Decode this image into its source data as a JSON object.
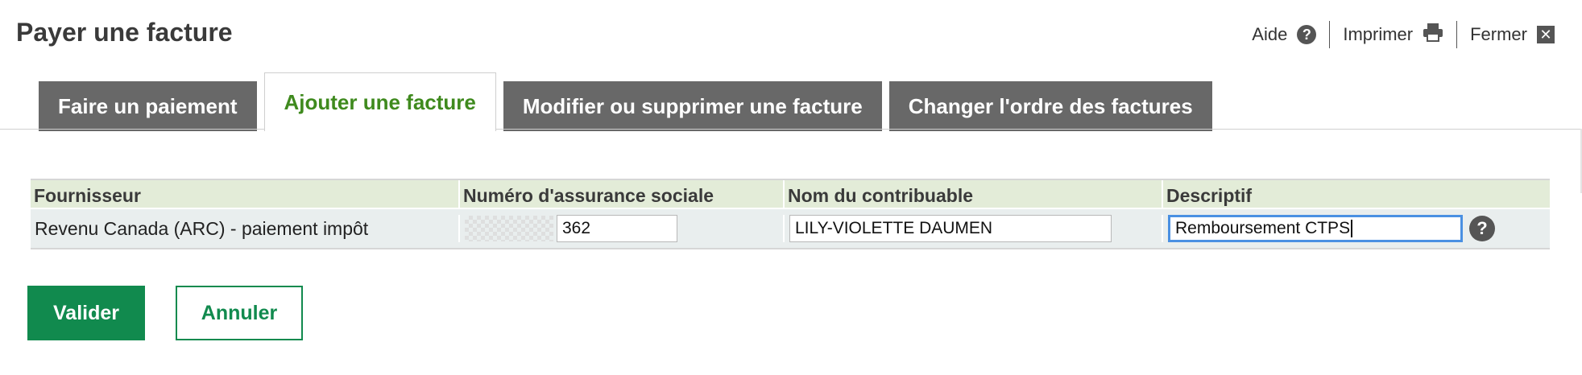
{
  "page_title": "Payer une facture",
  "header_links": {
    "help": "Aide",
    "print": "Imprimer",
    "close": "Fermer",
    "help_icon": "help-circle-icon",
    "print_icon": "printer-icon",
    "close_icon": "close-box-icon"
  },
  "tabs": [
    {
      "label": "Faire un paiement",
      "active": false
    },
    {
      "label": "Ajouter une facture",
      "active": true
    },
    {
      "label": "Modifier ou supprimer une facture",
      "active": false
    },
    {
      "label": "Changer l'ordre des factures",
      "active": false
    }
  ],
  "table": {
    "headers": [
      "Fournisseur",
      "Numéro d'assurance sociale",
      "Nom du contribuable",
      "Descriptif"
    ],
    "row": {
      "supplier": "Revenu Canada (ARC) - paiement impôt",
      "sin_visible": "362",
      "taxpayer_name": "LILY-VIOLETTE DAUMEN",
      "description": "Remboursement CTPS"
    }
  },
  "buttons": {
    "submit": "Valider",
    "cancel": "Annuler"
  },
  "colors": {
    "active_tab_text": "#3f8a1e",
    "tab_bg": "#686868",
    "primary_button": "#118a4e",
    "header_row": "#e3ecd8",
    "focus_border": "#4a90e2"
  }
}
